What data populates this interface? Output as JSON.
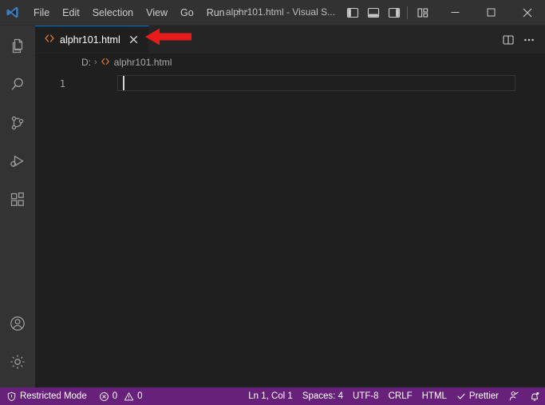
{
  "window": {
    "title": "alphr101.html - Visual S...",
    "logo_icon": "vscode-logo"
  },
  "menubar": {
    "items": [
      {
        "label": "File",
        "name": "menu-file"
      },
      {
        "label": "Edit",
        "name": "menu-edit"
      },
      {
        "label": "Selection",
        "name": "menu-selection"
      },
      {
        "label": "View",
        "name": "menu-view"
      },
      {
        "label": "Go",
        "name": "menu-go"
      },
      {
        "label": "Run",
        "name": "menu-run"
      },
      {
        "label": "···",
        "name": "menu-more"
      }
    ]
  },
  "titlebar_controls": {
    "toggle_primary_sidebar": "toggle-primary-sidebar-icon",
    "toggle_panel": "toggle-panel-icon",
    "toggle_secondary_sidebar": "toggle-secondary-sidebar-icon",
    "customize_layout": "customize-layout-icon",
    "minimize": "minimize-icon",
    "maximize": "maximize-icon",
    "close": "close-icon"
  },
  "activitybar": {
    "top_items": [
      {
        "name": "activity-explorer",
        "icon": "files-icon",
        "label": "Explorer"
      },
      {
        "name": "activity-search",
        "icon": "search-icon",
        "label": "Search"
      },
      {
        "name": "activity-source-control",
        "icon": "source-control-icon",
        "label": "Source Control"
      },
      {
        "name": "activity-run-debug",
        "icon": "run-and-debug-icon",
        "label": "Run and Debug"
      },
      {
        "name": "activity-extensions",
        "icon": "extensions-icon",
        "label": "Extensions"
      }
    ],
    "bottom_items": [
      {
        "name": "activity-accounts",
        "icon": "account-icon",
        "label": "Accounts"
      },
      {
        "name": "activity-settings",
        "icon": "gear-icon",
        "label": "Manage"
      }
    ]
  },
  "editor": {
    "tab": {
      "label": "alphr101.html",
      "file_icon": "html-file-icon",
      "close_icon": "close-icon"
    },
    "actions": {
      "split_editor": "split-editor-icon",
      "more_actions": "more-actions-icon"
    },
    "breadcrumbs": [
      {
        "label": "D:",
        "icon": ""
      },
      {
        "label": "alphr101.html",
        "icon": "html-file-icon"
      }
    ],
    "breadcrumb_separator": "›",
    "line_number": "1",
    "content": ""
  },
  "annotation": {
    "type": "arrow",
    "direction": "left",
    "color": "#e81b1b",
    "points_to": "tab-close-button"
  },
  "statusbar": {
    "left": [
      {
        "name": "status-restricted-mode",
        "icon": "shield-icon",
        "label": "Restricted Mode"
      },
      {
        "name": "status-problems",
        "icon": "error-warning-icon",
        "errors": "0",
        "warnings": "0"
      }
    ],
    "right": [
      {
        "name": "status-cursor-position",
        "label": "Ln 1, Col 1"
      },
      {
        "name": "status-indentation",
        "label": "Spaces: 4"
      },
      {
        "name": "status-encoding",
        "label": "UTF-8"
      },
      {
        "name": "status-eol",
        "label": "CRLF"
      },
      {
        "name": "status-language-mode",
        "label": "HTML"
      },
      {
        "name": "status-prettier",
        "label": "Prettier",
        "icon": "check-icon"
      },
      {
        "name": "status-feedback",
        "icon": "feedback-icon",
        "label": ""
      },
      {
        "name": "status-notifications",
        "icon": "bell-icon",
        "label": ""
      }
    ]
  },
  "colors": {
    "titlebar_bg": "#323233",
    "activitybar_bg": "#333333",
    "editor_bg": "#1f1f1f",
    "tabbar_bg": "#252526",
    "statusbar_bg": "#68217a",
    "tab_active_border": "#0078d4",
    "html_icon": "#e37933",
    "arrow_red": "#e81b1b"
  }
}
